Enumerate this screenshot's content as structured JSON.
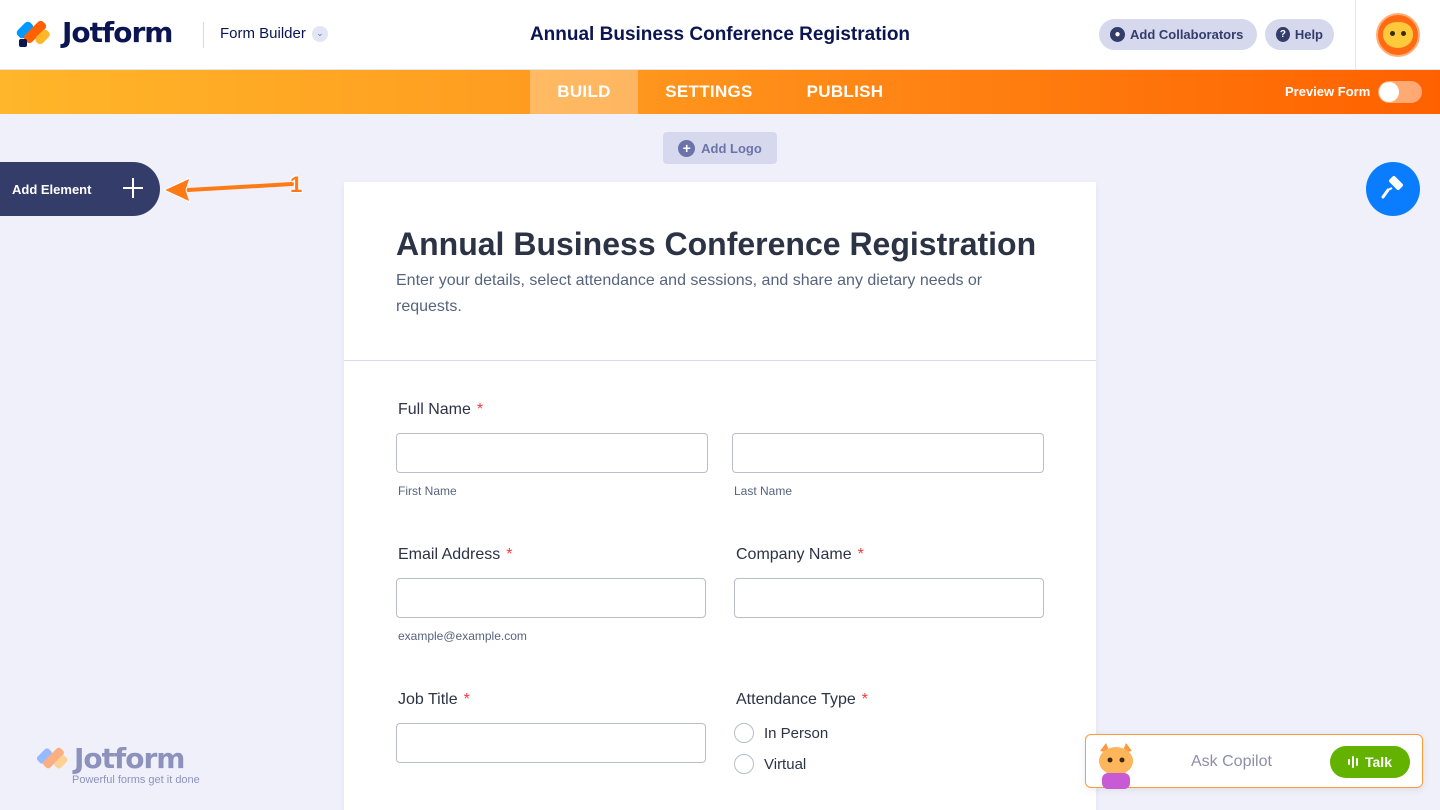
{
  "header": {
    "brand": "Jotform",
    "product_switch": "Form Builder",
    "title": "Annual Business Conference Registration",
    "add_collaborators": "Add Collaborators",
    "help": "Help"
  },
  "nav": {
    "tabs": [
      "BUILD",
      "SETTINGS",
      "PUBLISH"
    ],
    "active_tab": "BUILD",
    "preview_label": "Preview Form",
    "preview_enabled": false
  },
  "canvas": {
    "add_logo": "Add Logo",
    "add_element": "Add Element",
    "annotation_number": "1"
  },
  "form": {
    "title": "Annual Business Conference Registration",
    "subtitle": "Enter your details, select attendance and sessions, and share any dietary needs or requests.",
    "required_mark": "*",
    "fields": {
      "full_name": {
        "label": "Full Name",
        "first_sub": "First Name",
        "last_sub": "Last Name"
      },
      "email": {
        "label": "Email Address",
        "sub": "example@example.com"
      },
      "company": {
        "label": "Company Name"
      },
      "job_title": {
        "label": "Job Title"
      },
      "attendance": {
        "label": "Attendance Type",
        "options": [
          "In Person",
          "Virtual"
        ]
      }
    }
  },
  "watermark": {
    "brand": "Jotform",
    "tagline": "Powerful forms get it done"
  },
  "copilot": {
    "placeholder": "Ask Copilot",
    "talk_label": "Talk"
  },
  "colors": {
    "brand_navy": "#0a1551",
    "nav_orange_start": "#ffb629",
    "nav_orange_end": "#ff6100",
    "design_blue": "#0a7dff",
    "required_red": "#f23a3c",
    "talk_green": "#64b200"
  },
  "icons": [
    "jotform-logo-icon",
    "chevron-down-icon",
    "user-icon",
    "help-icon",
    "avatar-icon",
    "plus-icon",
    "paint-roller-icon",
    "annotation-arrow-icon",
    "copilot-cat-icon",
    "sound-wave-icon"
  ]
}
